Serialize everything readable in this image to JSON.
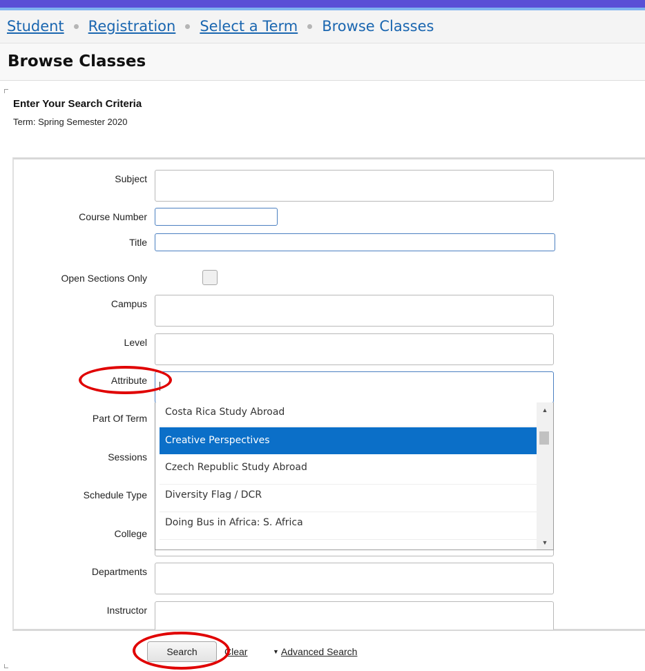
{
  "breadcrumb": {
    "items": [
      "Student",
      "Registration",
      "Select a Term"
    ],
    "current": "Browse Classes"
  },
  "page_title": "Browse Classes",
  "criteria": {
    "heading": "Enter Your Search Criteria",
    "term": "Term: Spring Semester 2020"
  },
  "form": {
    "subject_label": "Subject",
    "course_number_label": "Course Number",
    "title_label": "Title",
    "open_sections_label": "Open Sections Only",
    "campus_label": "Campus",
    "level_label": "Level",
    "attribute_label": "Attribute",
    "part_of_term_label": "Part Of Term",
    "sessions_label": "Sessions",
    "schedule_type_label": "Schedule Type",
    "college_label": "College",
    "departments_label": "Departments",
    "instructor_label": "Instructor",
    "open_sections_checked": false
  },
  "attribute_dropdown": {
    "options": [
      "Costa Rica Study Abroad",
      "Creative Perspectives",
      "Czech Republic Study Abroad",
      "Diversity Flag / DCR",
      "Doing Bus in Africa: S. Africa"
    ],
    "selected": "Creative Perspectives"
  },
  "actions": {
    "search": "Search",
    "clear": "Clear",
    "advanced_search": "Advanced Search"
  },
  "colors": {
    "top_bar": "#5a4fd6",
    "link": "#1a66b0",
    "selection": "#0b6fc8",
    "annotation": "#e00000"
  }
}
